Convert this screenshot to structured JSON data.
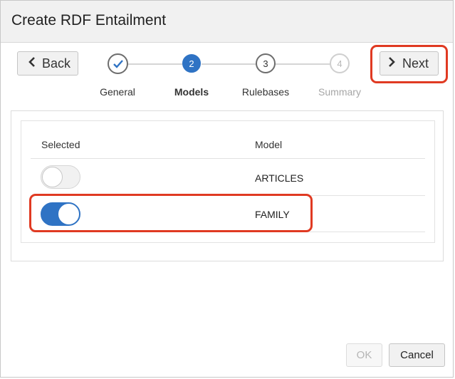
{
  "dialog": {
    "title": "Create RDF Entailment"
  },
  "toolbar": {
    "back_label": "Back",
    "next_label": "Next",
    "back_icon": "‹",
    "next_icon": "›"
  },
  "train": {
    "steps": [
      {
        "number": "✓",
        "label": "General",
        "state": "done"
      },
      {
        "number": "2",
        "label": "Models",
        "state": "current"
      },
      {
        "number": "3",
        "label": "Rulebases",
        "state": "next"
      },
      {
        "number": "4",
        "label": "Summary",
        "state": "disabled"
      }
    ]
  },
  "table": {
    "columns": [
      "Selected",
      "Model"
    ],
    "rows": [
      {
        "model": "ARTICLES",
        "selected": false
      },
      {
        "model": "FAMILY",
        "selected": true
      }
    ]
  },
  "footer": {
    "ok_label": "OK",
    "cancel_label": "Cancel"
  },
  "colors": {
    "accent": "#2f73c4",
    "highlight": "#e03a22"
  }
}
